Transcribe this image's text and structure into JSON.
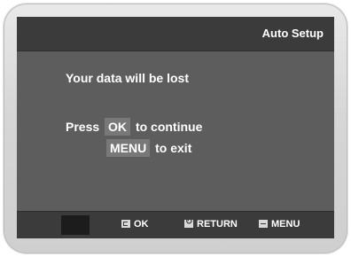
{
  "header": {
    "title": "Auto Setup"
  },
  "message": {
    "warning": "Your data will be lost",
    "press": "Press",
    "ok_key": "OK",
    "to_continue": "to continue",
    "menu_key": "MENU",
    "to_exit": "to exit"
  },
  "footer": {
    "ok_label": "OK",
    "return_label": "RETURN",
    "menu_label": "MENU"
  },
  "colors": {
    "screen_bg": "#5d5d5d",
    "bar_bg": "#3b3b3b",
    "key_highlight": "#787878"
  },
  "icons": [
    "ok-icon",
    "return-icon",
    "menu-icon"
  ]
}
